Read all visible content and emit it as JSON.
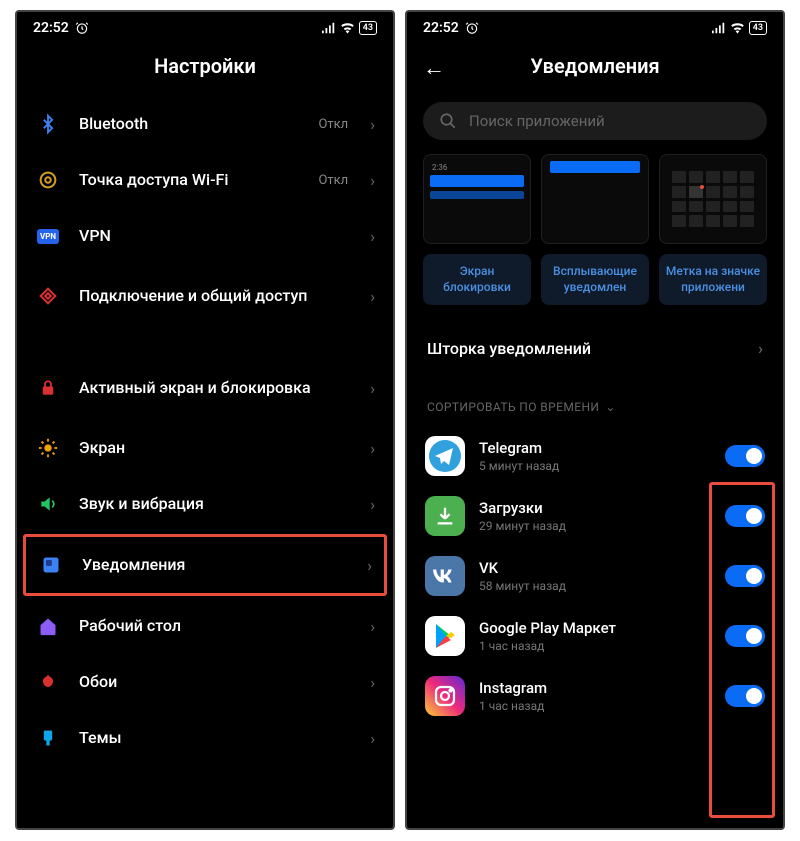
{
  "statusbar": {
    "time": "22:52",
    "battery": "43"
  },
  "left": {
    "title": "Настройки",
    "items": [
      {
        "icon": "bluetooth-icon",
        "label": "Bluetooth",
        "status": "Откл"
      },
      {
        "icon": "hotspot-icon",
        "label": "Точка доступа Wi-Fi",
        "status": "Откл"
      },
      {
        "icon": "vpn-icon",
        "label": "VPN",
        "status": ""
      },
      {
        "icon": "share-icon",
        "label": "Подключение и общий доступ",
        "status": ""
      }
    ],
    "items2": [
      {
        "icon": "lock-icon",
        "label": "Активный экран и блокировка"
      },
      {
        "icon": "brightness-icon",
        "label": "Экран"
      },
      {
        "icon": "sound-icon",
        "label": "Звук и вибрация"
      },
      {
        "icon": "notification-icon",
        "label": "Уведомления",
        "highlighted": true
      },
      {
        "icon": "home-icon",
        "label": "Рабочий стол"
      },
      {
        "icon": "wallpaper-icon",
        "label": "Обои"
      },
      {
        "icon": "theme-icon",
        "label": "Темы"
      }
    ]
  },
  "right": {
    "title": "Уведомления",
    "search_placeholder": "Поиск приложений",
    "card_labels": [
      "Экран блокировки",
      "Всплывающие уведомлен",
      "Метка на значке приложени"
    ],
    "card_lock_time": "2:36",
    "shade_label": "Шторка уведомлений",
    "sort_label": "СОРТИРОВАТЬ ПО ВРЕМЕНИ",
    "apps": [
      {
        "name": "Telegram",
        "sub": "5 минут назад",
        "icon": "telegram-icon",
        "on": true
      },
      {
        "name": "Загрузки",
        "sub": "29 минут назад",
        "icon": "download-icon",
        "on": true
      },
      {
        "name": "VK",
        "sub": "58 минут назад",
        "icon": "vk-icon",
        "on": true
      },
      {
        "name": "Google Play Маркет",
        "sub": "1 час назад",
        "icon": "play-icon",
        "on": true
      },
      {
        "name": "Instagram",
        "sub": "1 час назад",
        "icon": "instagram-icon",
        "on": true
      }
    ]
  }
}
